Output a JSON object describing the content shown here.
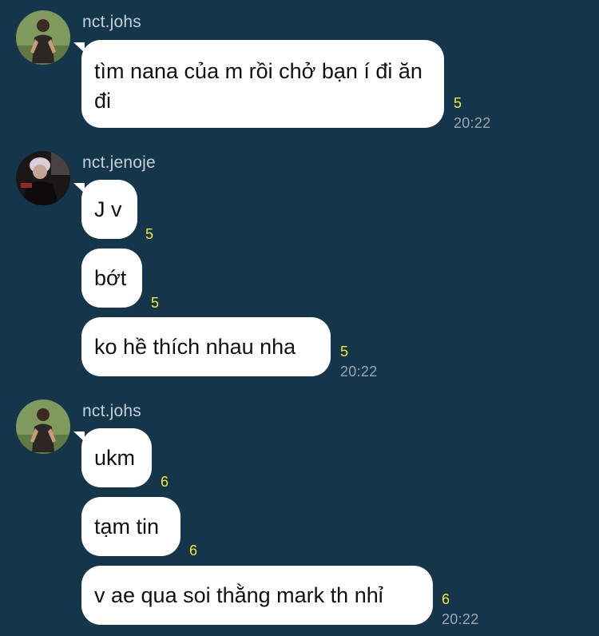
{
  "groups": [
    {
      "sender": "nct.johs",
      "avatar_icon": "user-avatar-green-icon",
      "messages": [
        {
          "text": "tìm nana của m rồi chở bạn í đi ăn đi",
          "read_count": "5",
          "time": "20:22"
        }
      ]
    },
    {
      "sender": "nct.jenoje",
      "avatar_icon": "user-avatar-dark-icon",
      "messages": [
        {
          "text": "J v",
          "read_count": "5"
        },
        {
          "text": "bớt",
          "read_count": "5"
        },
        {
          "text": "ko hề thích nhau nha",
          "read_count": "5",
          "time": "20:22"
        }
      ]
    },
    {
      "sender": "nct.johs",
      "avatar_icon": "user-avatar-green-icon",
      "messages": [
        {
          "text": "ukm",
          "read_count": "6"
        },
        {
          "text": "tạm tin",
          "read_count": "6"
        },
        {
          "text": "v ae qua soi thằng mark th nhỉ",
          "read_count": "6",
          "time": "20:22"
        }
      ]
    }
  ],
  "colors": {
    "background": "#14354a",
    "bubble": "#ffffff",
    "read_count": "#f2e93a",
    "timestamp": "#9aa8b2",
    "sender": "#c5d0d8"
  }
}
